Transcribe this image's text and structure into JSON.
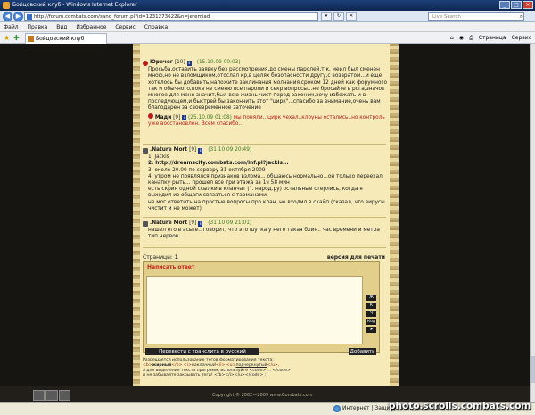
{
  "window": {
    "title": "Бойцовский клуб - Windows Internet Explorer",
    "address": "http://forum.combats.com/sand_forum.pl?id=1231273622&n=jeremiad",
    "search_placeholder": "Live Search"
  },
  "menu": [
    "Файл",
    "Правка",
    "Вид",
    "Избранное",
    "Сервис",
    "Справка"
  ],
  "tab": {
    "label": "Бойцовский клуб"
  },
  "toolbar": {
    "page_label": "Страница",
    "tools_label": "Сервис"
  },
  "posts": [
    {
      "author": "Юречег",
      "level": "[10]",
      "date": "(15.10.09 00:03)",
      "body": "Просьба,оставить заявку без рассмотрения,до смены паролей,т.к. меил был сменен мною,но не взломщиком,отослал кр,в целях безопасности другу,с возвратом...и еще хотелось бы добавить,наложите заклинания молчания,сроком 12 дней как форумного так и обычного,пока не сменю все пароли и секр вопросы...не бросайте в рога,значок многое для меня значит,был всю жизнь чист перед законом,хочу избежать и в последующем,и быстрей бы закончить этот \"цирк\"...спасибо за внимание,очень вам благодарен за своевременное заточение",
      "reply_author": "Мади",
      "reply_level": "[9]",
      "reply_date": "(25.10.09 01:08)",
      "reply_text": "мы поняли...цирк уехал..клоуны остались..но контроль уже восстановлен. Всем спасибо.."
    },
    {
      "author": ".Nature Mort",
      "level": "[9]",
      "date": "(31 10 09 20:49)",
      "lines": [
        "1. Jackis",
        "2.    http://dreamscity.combats.com/inf.pl?Jackis...",
        "3. около 20.00 по серверу 31 октября 2009",
        "4. утром не появлялся признаков взлома... общаюсь нормально...он только переехал канапку рыть... прошел все три этажа за 1ч 58 мин",
        "есть скрин одной ссылки в кланчат (\". народ.ру) остальные стерлись, когда я выходил из общаги связаться с тарманами.",
        "не мог ответить на простые вопросы про клан, не входил в скайп (сказал, что вирусы чистит и не может)"
      ]
    },
    {
      "author": ".Nature Mort",
      "level": "[9]",
      "date": "(31 10 09 21:01)",
      "body": "нашел его в аське...говорит, что это шутка у него такая блин.. час времени и метра тип нервов."
    }
  ],
  "pagination": {
    "label": "Страницы:",
    "current": "1",
    "print_label": "версия для печати"
  },
  "reply_form": {
    "title": "Написать ответ",
    "format_buttons": [
      "Ж",
      "К",
      "Ч",
      "Код",
      "➤"
    ],
    "translit_button": "Перевести с транслита в русский",
    "submit_button": "Добавить"
  },
  "rules": {
    "line1": "Разрешается использование тегов форматирования текста:",
    "line2_a": "<b>",
    "line2_b": "жирный",
    "line2_c": "</b> <i>",
    "line2_d": "наклонный",
    "line2_e": "</i> <u>",
    "line2_f": "подчеркнутый",
    "line2_g": "</u>,",
    "line3": "а для выделения текста программ, используйте <code> ... </code>",
    "line4": "и не забывайте закрывать теги! </b></i></u></code> :)"
  },
  "footer": {
    "copyright": "Copyright © 2002—2009 www.Combats.com"
  },
  "statusbar": {
    "done": "",
    "zone": "Интернет | Защищенный режим: вкл.",
    "zoom": "100%"
  },
  "watermark": "photo.scrolls.combats.com"
}
